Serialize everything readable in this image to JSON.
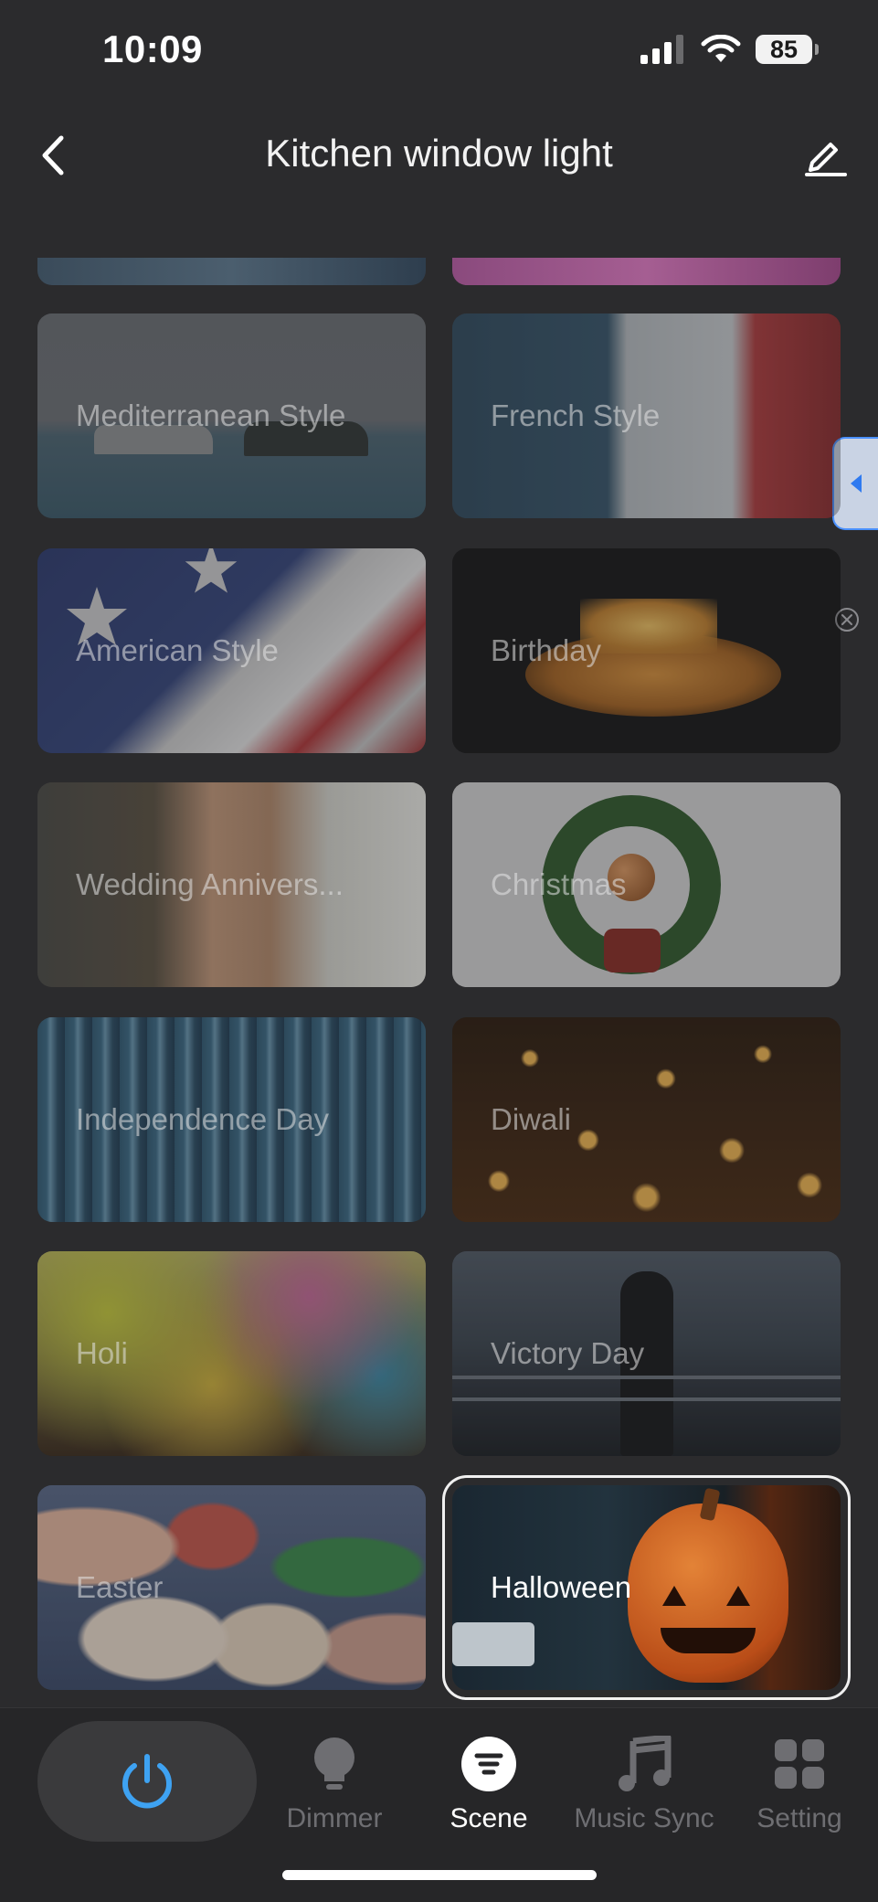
{
  "status_bar": {
    "time": "10:09",
    "battery": "85",
    "icons": [
      "signal-icon",
      "wifi-icon",
      "battery-icon"
    ]
  },
  "header": {
    "title": "Kitchen window light",
    "back_icon": "chevron-left-icon",
    "edit_icon": "pencil-icon"
  },
  "scenes": [
    {
      "label": "Mediterranean Style",
      "selected": false
    },
    {
      "label": "French Style",
      "selected": false
    },
    {
      "label": "American Style",
      "selected": false
    },
    {
      "label": "Birthday",
      "selected": false
    },
    {
      "label": "Wedding Annivers...",
      "selected": false
    },
    {
      "label": "Christmas",
      "selected": false
    },
    {
      "label": "Independence Day",
      "selected": false
    },
    {
      "label": "Diwali",
      "selected": false
    },
    {
      "label": "Holi",
      "selected": false
    },
    {
      "label": "Victory Day",
      "selected": false
    },
    {
      "label": "Easter",
      "selected": false
    },
    {
      "label": "Halloween",
      "selected": true
    }
  ],
  "bottom_nav": {
    "power_icon": "power-icon",
    "items": [
      {
        "label": "Dimmer",
        "icon": "bulb-icon",
        "active": false
      },
      {
        "label": "Scene",
        "icon": "scene-icon",
        "active": true
      },
      {
        "label": "Music Sync",
        "icon": "music-note-icon",
        "active": false
      },
      {
        "label": "Setting",
        "icon": "grid-icon",
        "active": false
      }
    ]
  },
  "colors": {
    "background": "#2b2b2d",
    "accent": "#3ea2f2",
    "inactive": "#6e6e72",
    "active": "#ffffff"
  }
}
